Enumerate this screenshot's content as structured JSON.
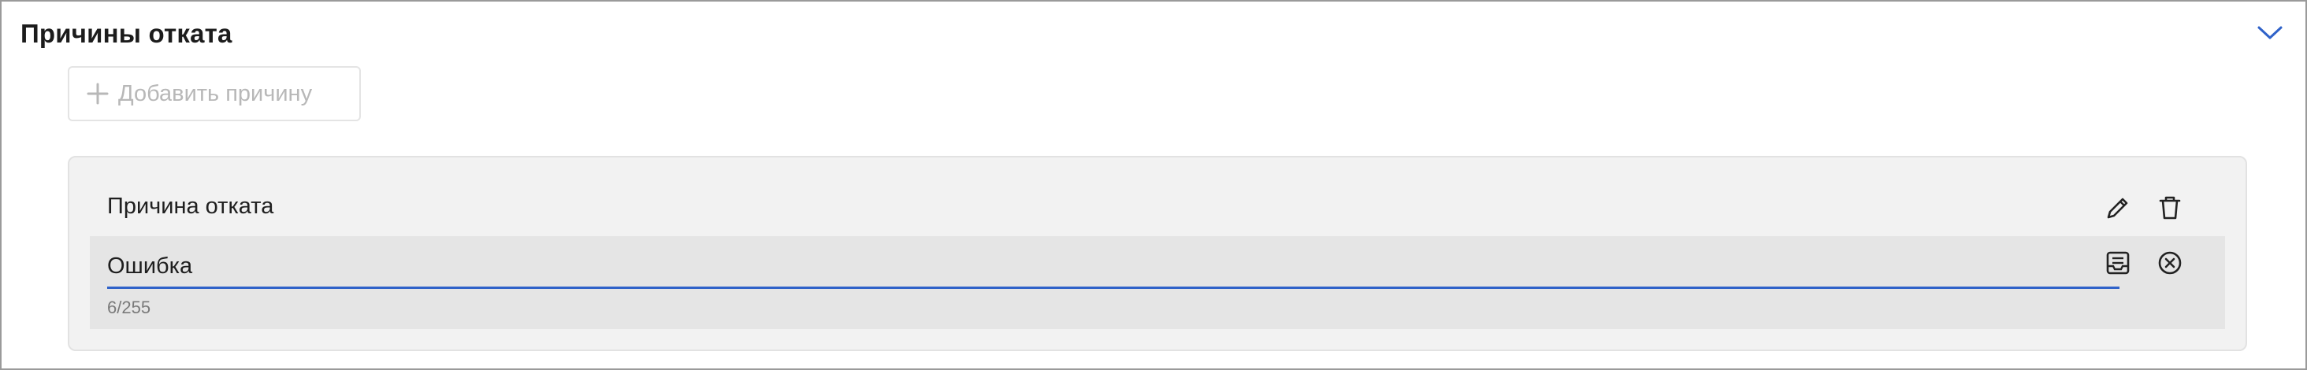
{
  "section": {
    "title": "Причины отката",
    "collapse_icon": "chevron-down-icon"
  },
  "add_button": {
    "label": "Добавить причину",
    "icon": "plus-icon"
  },
  "reason_card": {
    "title": "Причина отката",
    "edit_icon": "pencil-icon",
    "delete_icon": "trash-icon",
    "input": {
      "value": "Ошибка",
      "counter": "6/255"
    },
    "save_icon": "save-icon",
    "cancel_icon": "close-circle-icon"
  },
  "colors": {
    "accent": "#2f62c9",
    "card_background": "#f2f2f2",
    "edit_row_background": "#e5e5e5",
    "disabled_text": "#b8b8b8"
  }
}
